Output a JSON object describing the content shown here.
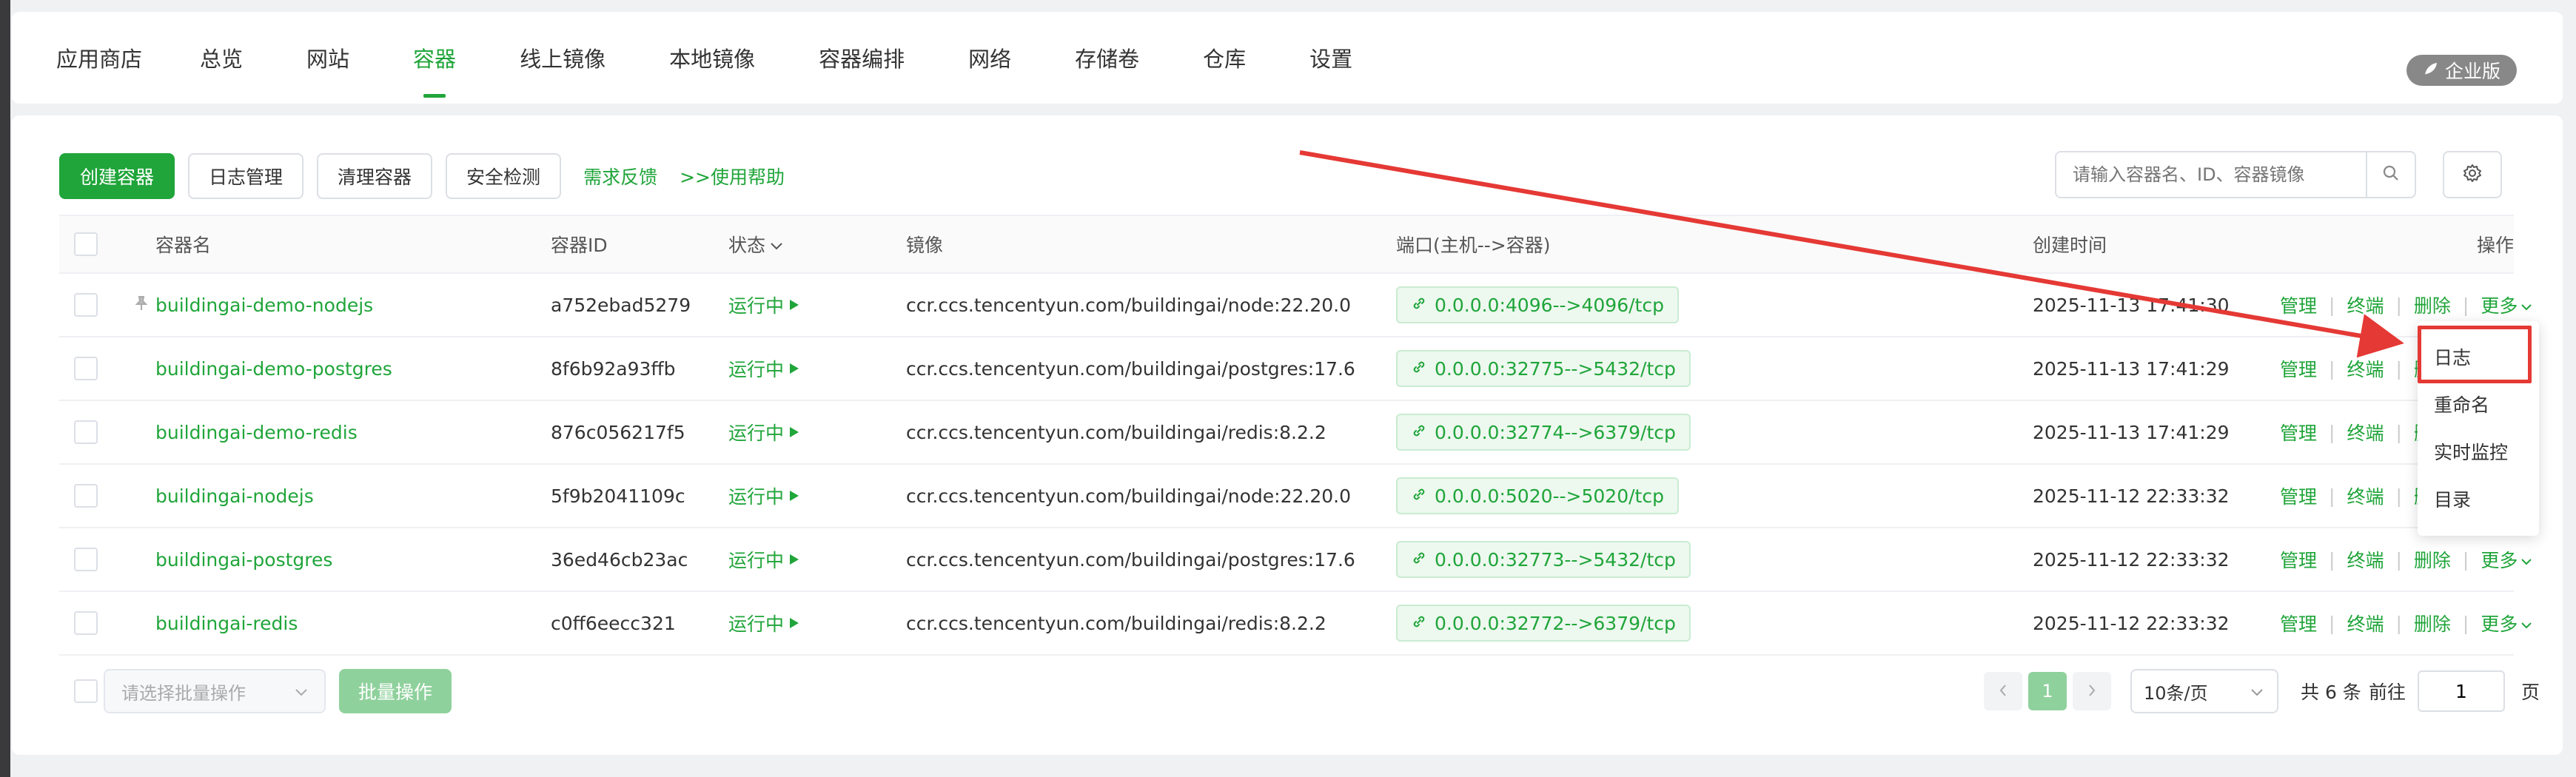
{
  "nav": {
    "items": [
      "应用商店",
      "总览",
      "网站",
      "容器",
      "线上镜像",
      "本地镜像",
      "容器编排",
      "网络",
      "存储卷",
      "仓库",
      "设置"
    ],
    "active_index": 3,
    "enterprise_badge": "企业版"
  },
  "toolbar": {
    "create_label": "创建容器",
    "log_label": "日志管理",
    "clean_label": "清理容器",
    "security_label": "安全检测",
    "feedback_link": "需求反馈",
    "help_link": ">>使用帮助"
  },
  "search": {
    "placeholder": "请输入容器名、ID、容器镜像"
  },
  "table": {
    "headers": {
      "name": "容器名",
      "id": "容器ID",
      "status": "状态",
      "image": "镜像",
      "port": "端口(主机-->容器)",
      "created": "创建时间",
      "ops": "操作"
    },
    "rows": [
      {
        "name": "buildingai-demo-nodejs",
        "id": "a752ebad5279",
        "status": "运行中",
        "image": "ccr.ccs.tencentyun.com/buildingai/node:22.20.0",
        "port": "0.0.0.0:4096-->4096/tcp",
        "created": "2025-11-13 17:41:30",
        "pinned": true
      },
      {
        "name": "buildingai-demo-postgres",
        "id": "8f6b92a93ffb",
        "status": "运行中",
        "image": "ccr.ccs.tencentyun.com/buildingai/postgres:17.6",
        "port": "0.0.0.0:32775-->5432/tcp",
        "created": "2025-11-13 17:41:29",
        "pinned": false
      },
      {
        "name": "buildingai-demo-redis",
        "id": "876c056217f5",
        "status": "运行中",
        "image": "ccr.ccs.tencentyun.com/buildingai/redis:8.2.2",
        "port": "0.0.0.0:32774-->6379/tcp",
        "created": "2025-11-13 17:41:29",
        "pinned": false
      },
      {
        "name": "buildingai-nodejs",
        "id": "5f9b2041109c",
        "status": "运行中",
        "image": "ccr.ccs.tencentyun.com/buildingai/node:22.20.0",
        "port": "0.0.0.0:5020-->5020/tcp",
        "created": "2025-11-12 22:33:32",
        "pinned": false
      },
      {
        "name": "buildingai-postgres",
        "id": "36ed46cb23ac",
        "status": "运行中",
        "image": "ccr.ccs.tencentyun.com/buildingai/postgres:17.6",
        "port": "0.0.0.0:32773-->5432/tcp",
        "created": "2025-11-12 22:33:32",
        "pinned": false
      },
      {
        "name": "buildingai-redis",
        "id": "c0ff6eecc321",
        "status": "运行中",
        "image": "ccr.ccs.tencentyun.com/buildingai/redis:8.2.2",
        "port": "0.0.0.0:32772-->6379/tcp",
        "created": "2025-11-12 22:33:32",
        "pinned": false
      }
    ],
    "ops": {
      "manage": "管理",
      "terminal": "终端",
      "delete": "删除",
      "more": "更多"
    }
  },
  "footer": {
    "batch_placeholder": "请选择批量操作",
    "batch_button": "批量操作",
    "current_page": "1",
    "page_size": "10条/页",
    "total": "共 6 条",
    "goto_label": "前往",
    "goto_value": "1",
    "page_suffix": "页"
  },
  "dropdown": {
    "items": [
      "日志",
      "重命名",
      "实时监控",
      "目录"
    ],
    "highlighted": "日志"
  },
  "colors": {
    "accent": "#20a53a",
    "annotation": "#e53935"
  }
}
